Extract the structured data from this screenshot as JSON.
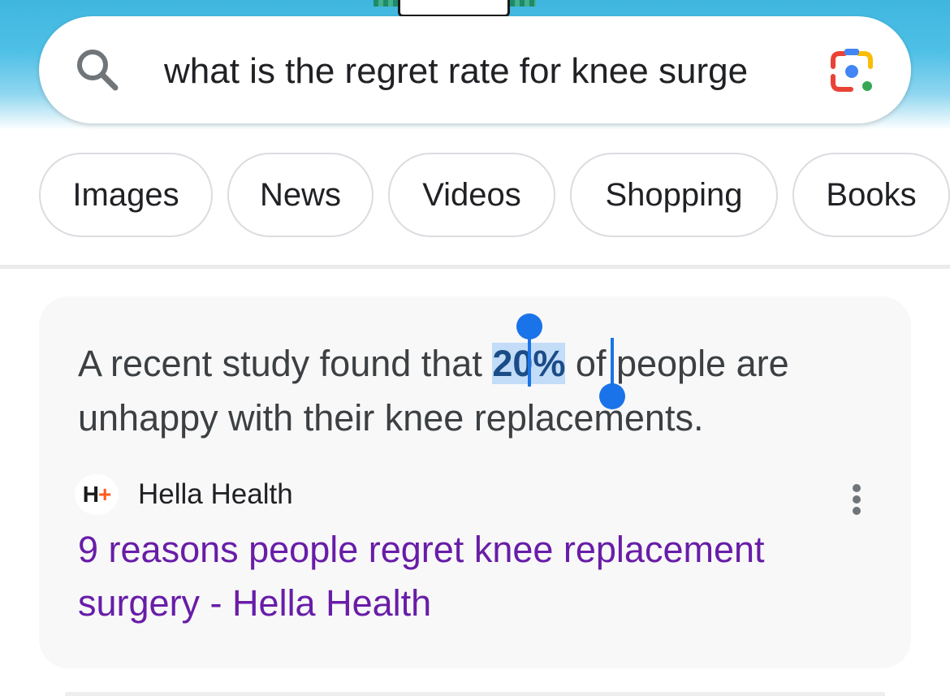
{
  "search": {
    "query": "what is the regret rate for knee surge"
  },
  "chips": [
    {
      "label": "Images"
    },
    {
      "label": "News"
    },
    {
      "label": "Videos"
    },
    {
      "label": "Shopping"
    },
    {
      "label": "Books"
    }
  ],
  "result": {
    "snippet_before": "A recent study found that ",
    "snippet_highlight": "20%",
    "snippet_after": " of people are unhappy with their knee replacements.",
    "source": {
      "favicon_text": "H",
      "favicon_plus": "+",
      "name": "Hella Health"
    },
    "link_title": "9 reasons people regret knee replacement surgery - Hella Health"
  },
  "colors": {
    "header_blue": "#4fc0e6",
    "selection": "#1a73e8",
    "visited_link": "#681da8",
    "favicon_accent": "#ff5a1f"
  },
  "icons": {
    "search": "search-icon",
    "lens": "google-lens-icon",
    "more": "more-vert-icon"
  }
}
